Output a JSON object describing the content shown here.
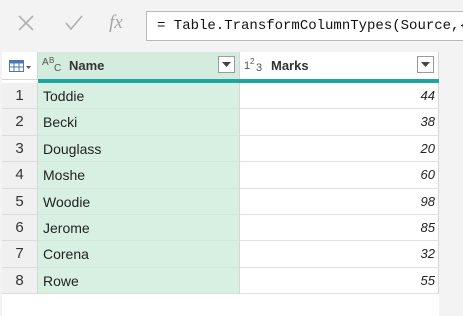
{
  "formula_bar": {
    "cancel_icon": "x-icon",
    "commit_icon": "check-icon",
    "fx_label": "fx",
    "formula": "= Table.TransformColumnTypes(Source,{"
  },
  "grid": {
    "columns": [
      {
        "name": "Name",
        "type_icon": "ABC",
        "type": "text"
      },
      {
        "name": "Marks",
        "type_icon": "123",
        "type": "whole-number"
      }
    ],
    "rows": [
      {
        "n": "1",
        "name": "Toddie",
        "marks": "44"
      },
      {
        "n": "2",
        "name": "Becki",
        "marks": "38"
      },
      {
        "n": "3",
        "name": "Douglass",
        "marks": "20"
      },
      {
        "n": "4",
        "name": "Moshe",
        "marks": "60"
      },
      {
        "n": "5",
        "name": "Woodie",
        "marks": "98"
      },
      {
        "n": "6",
        "name": "Jerome",
        "marks": "85"
      },
      {
        "n": "7",
        "name": "Corena",
        "marks": "32"
      },
      {
        "n": "8",
        "name": "Rowe",
        "marks": "55"
      }
    ]
  },
  "colors": {
    "selected_column": "#d8f0e2",
    "header_underline": "#1fa5a0"
  }
}
